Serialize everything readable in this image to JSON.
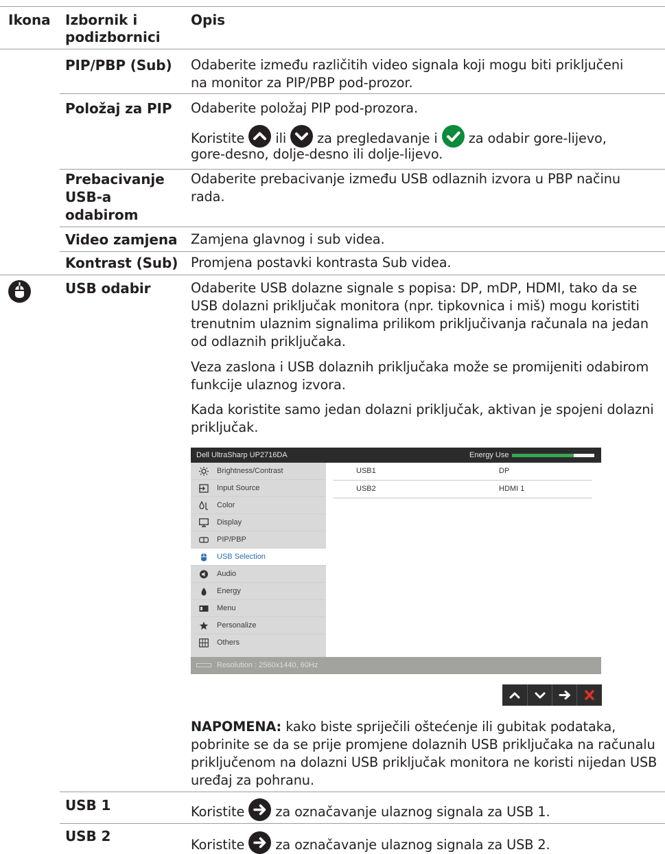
{
  "header": {
    "col1": "Ikona",
    "col2": "Izbornik i podizbornici",
    "col3": "Opis"
  },
  "rows": {
    "pip_sub": {
      "name": "PIP/PBP (Sub)",
      "desc": "Odaberite između različitih video signala koji mogu biti priključeni na monitor za PIP/PBP pod-prozor."
    },
    "pip_pos": {
      "name": "Položaj za PIP",
      "desc1": "Odaberite položaj PIP pod-prozora.",
      "desc2_a": "Koristite",
      "desc2_b": "ili",
      "desc2_c": "za pregledavanje i",
      "desc2_d": "za odabir gore-lijevo,",
      "desc2_e": "gore-desno, dolje-desno ili dolje-lijevo."
    },
    "usb_switch": {
      "name": "Prebacivanje USB-a odabirom",
      "desc": "Odaberite prebacivanje između USB odlaznih izvora u PBP načinu rada."
    },
    "video_swap": {
      "name": "Video zamjena",
      "desc": "Zamjena glavnog i sub videa."
    },
    "contrast_sub": {
      "name": "Kontrast (Sub)",
      "desc": "Promjena postavki kontrasta Sub videa."
    },
    "usb_sel": {
      "name": "USB odabir",
      "p1": "Odaberite USB dolazne signale s popisa: DP, mDP, HDMI, tako da se USB dolazni priključak monitora (npr. tipkovnica i miš) mogu koristiti trenutnim ulaznim signalima prilikom priključivanja računala na jedan od odlaznih priključaka.",
      "p2": "Veza zaslona i USB dolaznih priključaka može se promijeniti odabirom funkcije ulaznog izvora.",
      "p3": "Kada koristite samo jedan dolazni priključak, aktivan je spojeni dolazni priključak.",
      "note_label": "NAPOMENA:",
      "note_text": " kako biste spriječili oštećenje ili gubitak podataka, pobrinite se da se prije promjene dolaznih USB priključaka na računalu priključenom na dolazni USB priključak monitora ne koristi nijedan USB uređaj za pohranu."
    },
    "usb1": {
      "name": "USB 1",
      "desc_a": "Koristite",
      "desc_b": "za označavanje ulaznog signala za USB 1."
    },
    "usb2": {
      "name": "USB 2",
      "desc_a": "Koristite",
      "desc_b": "za označavanje ulaznog signala za USB 2."
    }
  },
  "osd": {
    "title": "Dell UltraSharp UP2716DA",
    "energy_label": "Energy Use",
    "energy_level": 0.75,
    "menu": [
      {
        "label": "Brightness/Contrast",
        "icon": "sun-icon"
      },
      {
        "label": "Input Source",
        "icon": "input-icon"
      },
      {
        "label": "Color",
        "icon": "color-icon"
      },
      {
        "label": "Display",
        "icon": "display-icon"
      },
      {
        "label": "PIP/PBP",
        "icon": "pip-icon"
      },
      {
        "label": "USB Selection",
        "icon": "usb-mouse-icon"
      },
      {
        "label": "Audio",
        "icon": "speaker-icon"
      },
      {
        "label": "Energy",
        "icon": "energy-icon"
      },
      {
        "label": "Menu",
        "icon": "menu-icon"
      },
      {
        "label": "Personalize",
        "icon": "star-icon"
      },
      {
        "label": "Others",
        "icon": "others-icon"
      }
    ],
    "selected_index": 5,
    "settings": [
      {
        "key": "USB1",
        "value": "DP"
      },
      {
        "key": "USB2",
        "value": "HDMI 1"
      }
    ],
    "footer": "Resolution : 2560x1440, 60Hz",
    "buttons": [
      "up-icon",
      "down-icon",
      "right-arrow-icon",
      "close-icon"
    ]
  },
  "colors": {
    "text": "#231f20",
    "rule": "#9d9d9d",
    "check_green": "#0d8a3c",
    "osd_selected": "#2a6fb4",
    "energy_green": "#35a852",
    "close_red": "#e0302a"
  }
}
